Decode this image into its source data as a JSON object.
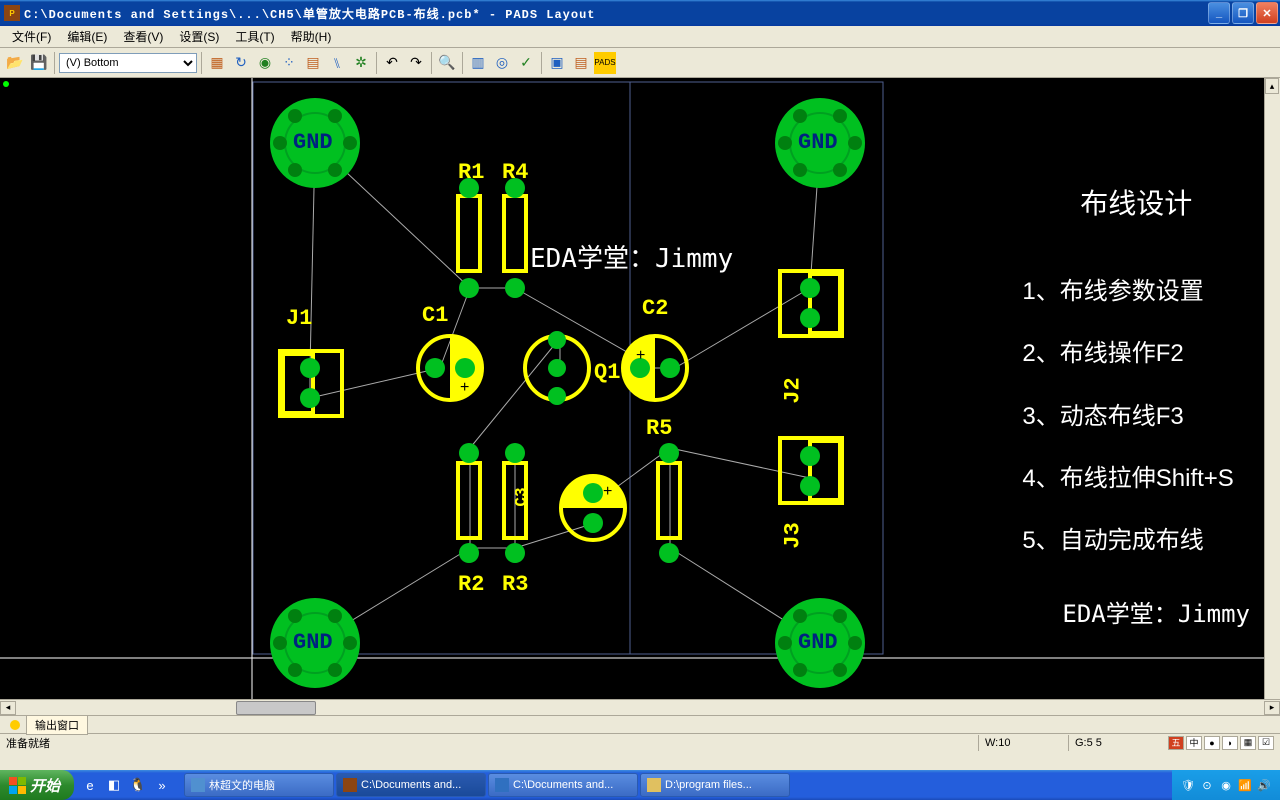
{
  "title": "C:\\Documents and Settings\\...\\CH5\\单管放大电路PCB-布线.pcb* - PADS Layout",
  "menu": {
    "file": "文件(F)",
    "edit": "编辑(E)",
    "view": "查看(V)",
    "setup": "设置(S)",
    "tool": "工具(T)",
    "help": "帮助(H)"
  },
  "layer": "(V) Bottom",
  "output_tab": "输出窗口",
  "status_ready": "准备就绪",
  "status_w": "W:10",
  "status_g": "G:5 5",
  "taskbar": {
    "start": "开始",
    "task1": "林超文的电脑",
    "task2": "C:\\Documents and...",
    "task3": "C:\\Documents and...",
    "task4": "D:\\program files..."
  },
  "side": {
    "title": "布线设计",
    "i1": "1、布线参数设置",
    "i2": "2、布线操作F2",
    "i3": "3、动态布线F3",
    "i4": "4、布线拉伸Shift+S",
    "i5": "5、自动完成布线",
    "footer": "EDA学堂：Jimmy"
  },
  "watermark": "EDA学堂：Jimmy",
  "pcb": {
    "R1": "R1",
    "R2": "R2",
    "R3": "R3",
    "R4": "R4",
    "R5": "R5",
    "C1": "C1",
    "C2": "C2",
    "Q1": "Q1",
    "J1": "J1",
    "J2": "J2",
    "J3": "J3",
    "GND": "GND"
  }
}
